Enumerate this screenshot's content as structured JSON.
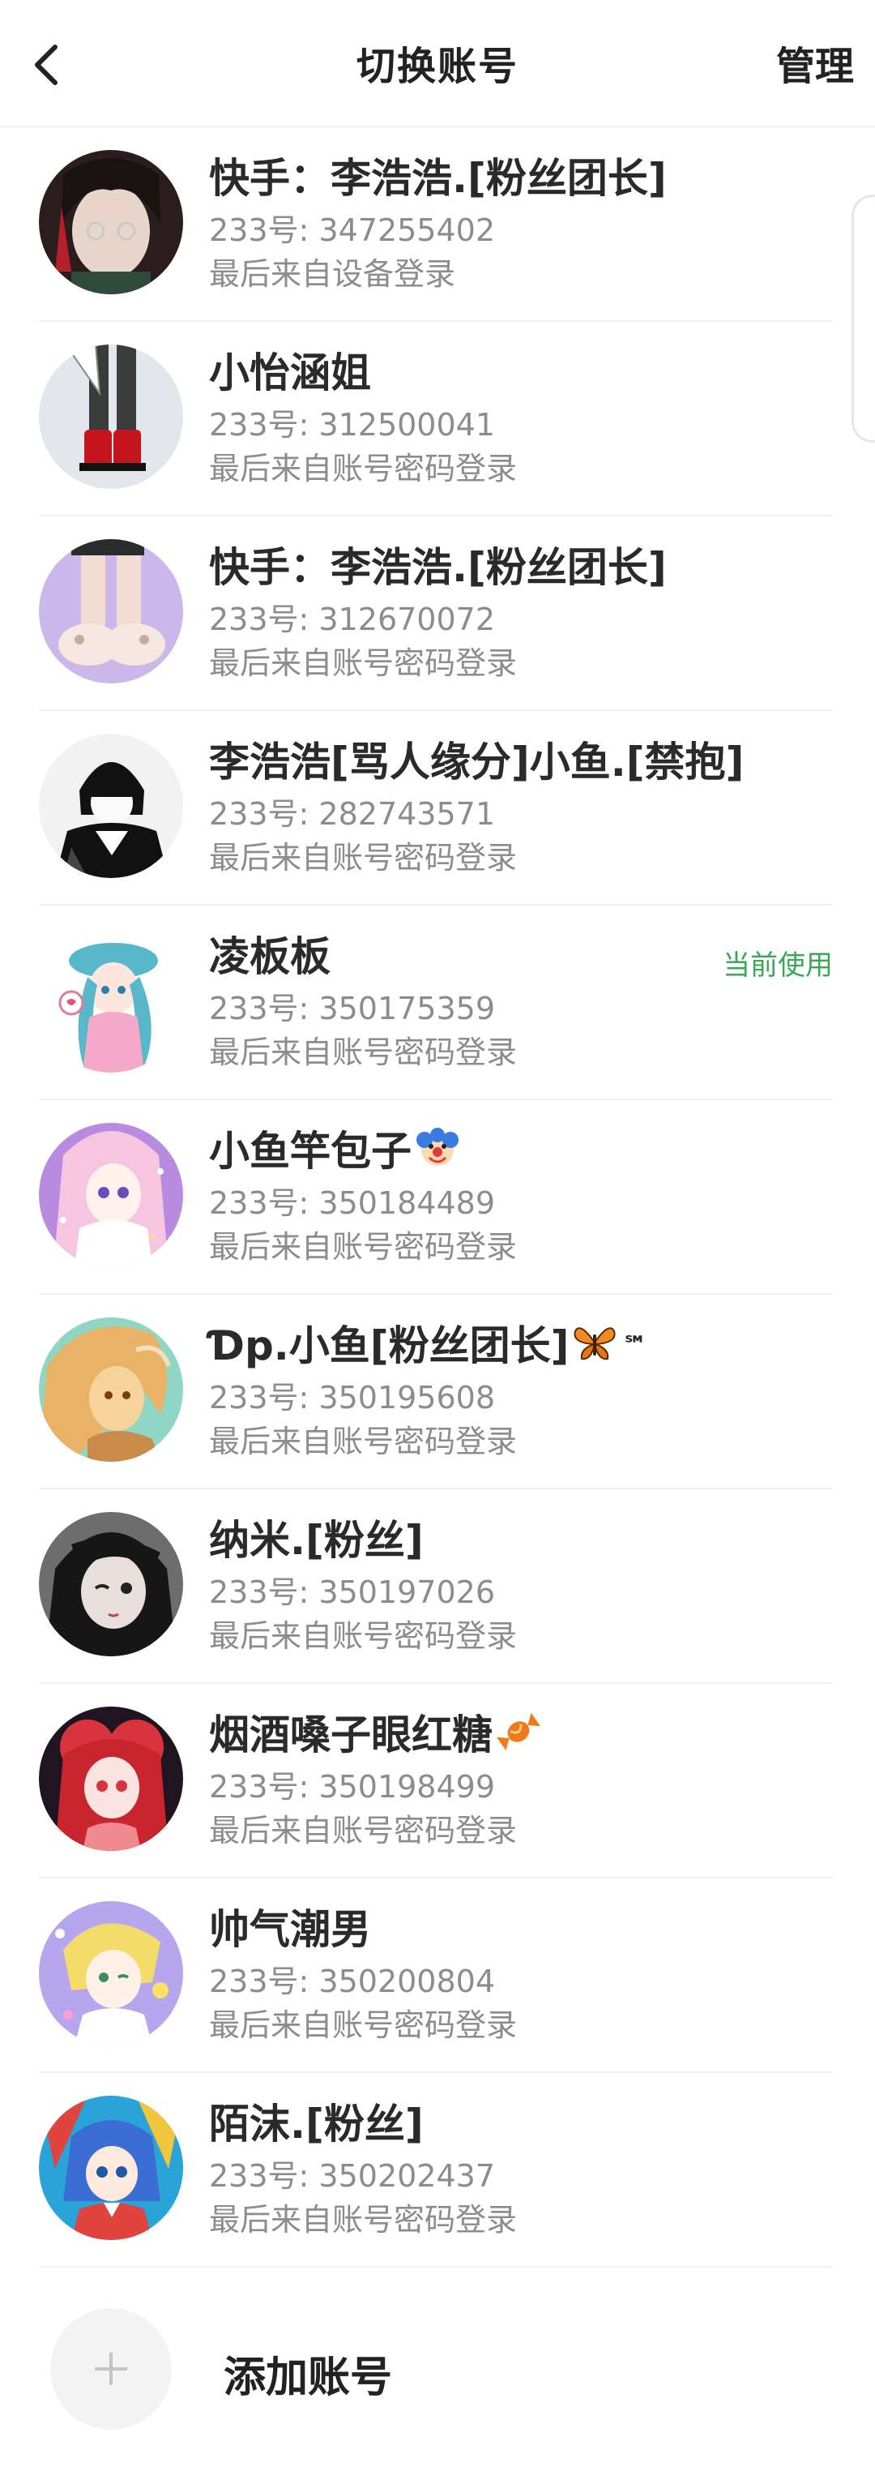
{
  "header": {
    "title": "切换账号",
    "manage_label": "管理",
    "back_icon": "chevron-left-icon"
  },
  "accounts": [
    {
      "name": "快手：李浩浩.[粉丝团长]",
      "id": "233号: 347255402",
      "login": "最后来自设备登录",
      "current": "",
      "avatar_colors": [
        "#2b1d1d",
        "#e8d6cc",
        "#b3202a"
      ]
    },
    {
      "name": "小怡涵姐",
      "id": "233号: 312500041",
      "login": "最后来自账号密码登录",
      "current": "",
      "avatar_colors": [
        "#e3e6ea",
        "#3b3b3b",
        "#c4151f"
      ]
    },
    {
      "name": "快手：李浩浩.[粉丝团长]",
      "id": "233号: 312670072",
      "login": "最后来自账号密码登录",
      "current": "",
      "avatar_colors": [
        "#cbb7ea",
        "#f3dcd3",
        "#c9a9a0"
      ]
    },
    {
      "name": "李浩浩[骂人缘分]小鱼.[禁抱]",
      "id": "233号: 282743571",
      "login": "最后来自账号密码登录",
      "current": "",
      "avatar_colors": [
        "#f2f2f2",
        "#111111",
        "#444444"
      ]
    },
    {
      "name": "凌板板",
      "id": "233号: 350175359",
      "login": "最后来自账号密码登录",
      "current": "当前使用",
      "avatar_colors": [
        "#ffffff",
        "#f4a9c8",
        "#58b7c9"
      ]
    },
    {
      "name": "小鱼竿包子",
      "name_emoji": "clown-emoji",
      "id": "233号: 350184489",
      "login": "最后来自账号密码登录",
      "current": "",
      "avatar_colors": [
        "#b98be0",
        "#f6c6e0",
        "#6d4bb8"
      ]
    },
    {
      "name": "Ɗp.小鱼[粉丝团长]",
      "name_emoji": "butterfly-emoji",
      "name_suffix": "℠",
      "id": "233号: 350195608",
      "login": "最后来自账号密码登录",
      "current": "",
      "avatar_colors": [
        "#8fd6c4",
        "#e9b266",
        "#f6d39a"
      ]
    },
    {
      "name": "纳米.[粉丝]",
      "id": "233号: 350197026",
      "login": "最后来自账号密码登录",
      "current": "",
      "avatar_colors": [
        "#6d6d6d",
        "#161616",
        "#e8dfdc"
      ]
    },
    {
      "name": "烟酒嗓子眼红糖",
      "name_emoji": "candy-emoji",
      "id": "233号: 350198499",
      "login": "最后来自账号密码登录",
      "current": "",
      "avatar_colors": [
        "#1f1420",
        "#d9333d",
        "#f08a90"
      ]
    },
    {
      "name": "帅气潮男",
      "id": "233号: 350200804",
      "login": "最后来自账号密码登录",
      "current": "",
      "avatar_colors": [
        "#b6a6ee",
        "#f4dc6a",
        "#ffffff"
      ]
    },
    {
      "name": "陌沫.[粉丝]",
      "id": "233号: 350202437",
      "login": "最后来自账号密码登录",
      "current": "",
      "avatar_colors": [
        "#2aa3d9",
        "#e0443e",
        "#3b6ed3"
      ]
    }
  ],
  "add_account": {
    "label": "添加账号",
    "icon": "plus-icon"
  },
  "colors": {
    "current_badge": "#3aa757",
    "secondary_text": "#8c8c8c",
    "divider": "#eeeeee"
  }
}
